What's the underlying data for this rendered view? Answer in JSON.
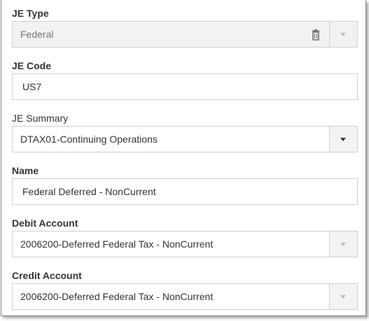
{
  "je_type": {
    "label": "JE Type",
    "value": "Federal"
  },
  "je_code": {
    "label": "JE Code",
    "value": "US7"
  },
  "je_summary": {
    "label": "JE Summary",
    "value": "DTAX01-Continuing Operations"
  },
  "name": {
    "label": "Name",
    "value": "Federal Deferred - NonCurrent"
  },
  "debit_account": {
    "label": "Debit Account",
    "value": "2006200-Deferred Federal Tax - NonCurrent"
  },
  "credit_account": {
    "label": "Credit Account",
    "value": "2006200-Deferred Federal Tax - NonCurrent"
  },
  "icons": {
    "clear": "trash-icon",
    "dropdown": "chevron-down-icon"
  }
}
